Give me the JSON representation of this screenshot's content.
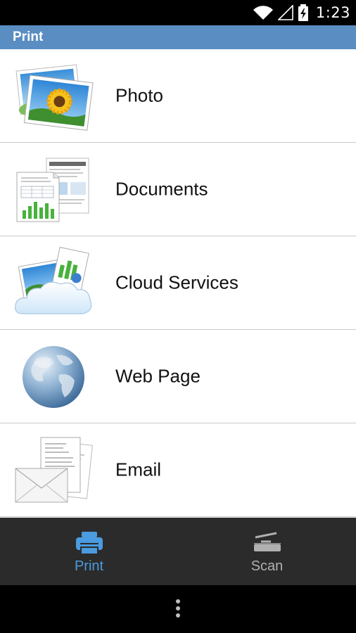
{
  "status_bar": {
    "time": "1:23",
    "icons": [
      "wifi-icon",
      "cell-signal-icon",
      "battery-charging-icon"
    ]
  },
  "header": {
    "title": "Print",
    "color": "#5a8dc2"
  },
  "menu": {
    "items": [
      {
        "label": "Photo",
        "icon": "photo-icon"
      },
      {
        "label": "Documents",
        "icon": "documents-icon"
      },
      {
        "label": "Cloud Services",
        "icon": "cloud-services-icon"
      },
      {
        "label": "Web Page",
        "icon": "web-page-icon"
      },
      {
        "label": "Email",
        "icon": "email-icon"
      }
    ]
  },
  "bottom_nav": {
    "tabs": [
      {
        "label": "Print",
        "icon": "printer-icon",
        "active": true,
        "color": "#4a9be0"
      },
      {
        "label": "Scan",
        "icon": "scanner-icon",
        "active": false,
        "color": "#b0b0b0"
      }
    ]
  },
  "system_nav": {
    "icons": [
      "overflow-menu-icon"
    ]
  }
}
